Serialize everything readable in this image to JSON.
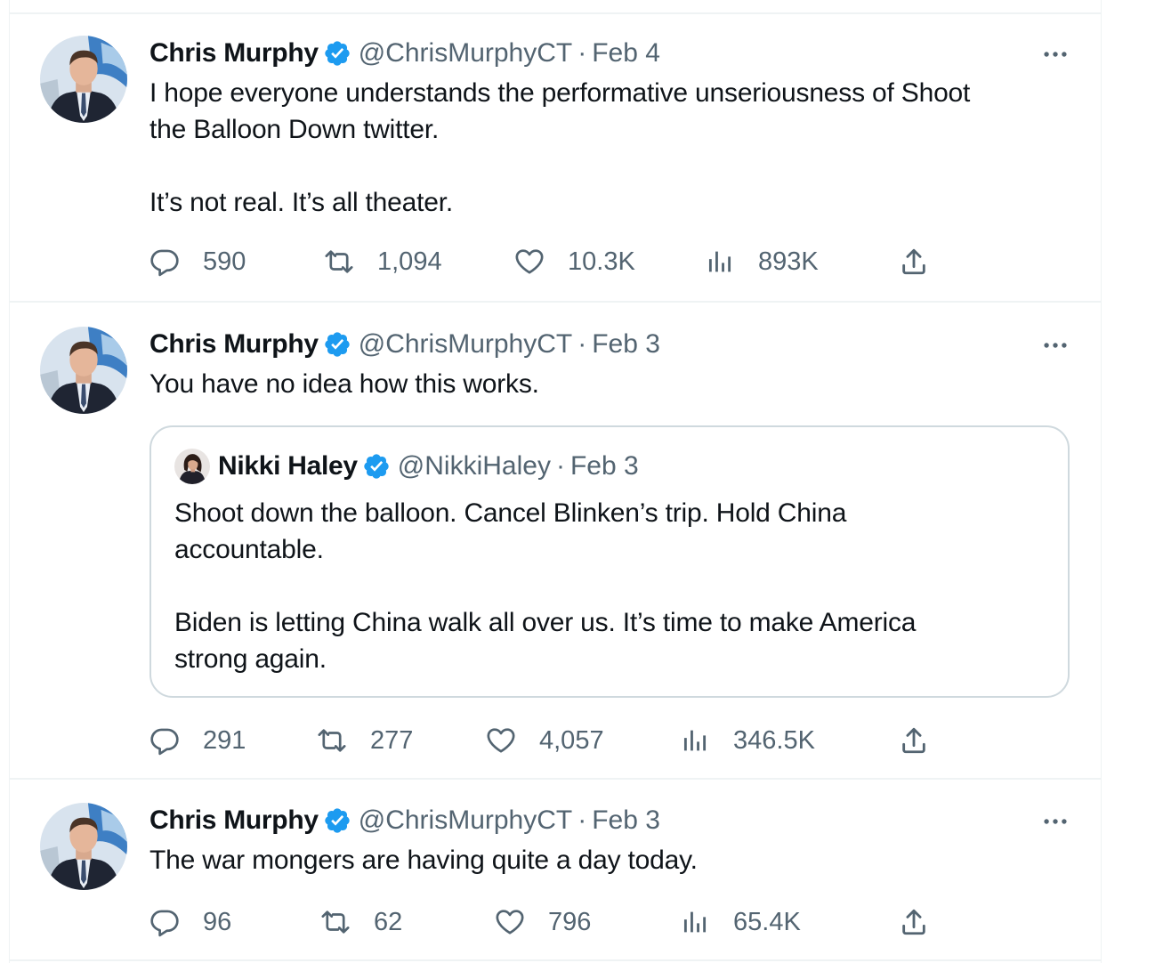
{
  "colors": {
    "verified": "#1d9bf0",
    "secondary": "#536471",
    "border": "#eff3f4"
  },
  "tweets": [
    {
      "name": "Chris Murphy",
      "handle": "@ChrisMurphyCT",
      "separator": "·",
      "date": "Feb 4",
      "text_lines": [
        "I hope everyone understands the performative unseriousness of Shoot",
        "the Balloon Down twitter.",
        "",
        "It’s not real. It’s all theater."
      ],
      "replies": "590",
      "retweets": "1,094",
      "likes": "10.3K",
      "views": "893K"
    },
    {
      "name": "Chris Murphy",
      "handle": "@ChrisMurphyCT",
      "separator": "·",
      "date": "Feb 3",
      "text_lines": [
        "You have no idea how this works."
      ],
      "quote": {
        "name": "Nikki Haley",
        "handle": "@NikkiHaley",
        "separator": "·",
        "date": "Feb 3",
        "text_lines": [
          "Shoot down the balloon. Cancel Blinken’s trip. Hold China",
          "accountable.",
          "",
          "Biden is letting China walk all over us. It’s time to make America",
          "strong again."
        ]
      },
      "replies": "291",
      "retweets": "277",
      "likes": "4,057",
      "views": "346.5K"
    },
    {
      "name": "Chris Murphy",
      "handle": "@ChrisMurphyCT",
      "separator": "·",
      "date": "Feb 3",
      "text_lines": [
        "The war mongers are having quite a day today."
      ],
      "replies": "96",
      "retweets": "62",
      "likes": "796",
      "views": "65.4K"
    }
  ],
  "icons": {
    "reply": "reply-icon",
    "retweet": "retweet-icon",
    "like": "heart-icon",
    "views": "views-icon",
    "share": "share-icon",
    "more": "more-icon",
    "verified": "verified-badge-icon"
  }
}
